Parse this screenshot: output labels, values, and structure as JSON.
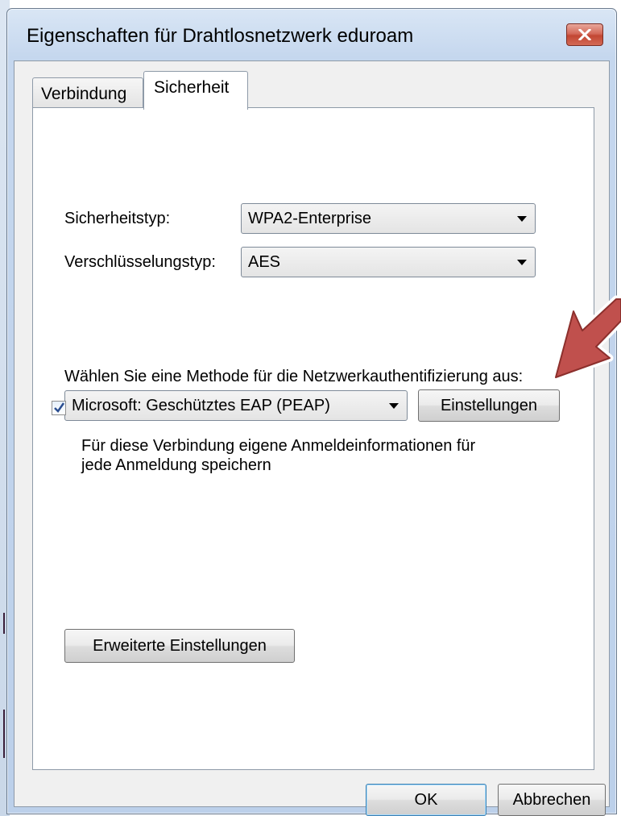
{
  "window": {
    "title": "Eigenschaften für Drahtlosnetzwerk eduroam",
    "close_icon": "close-icon"
  },
  "tabs": [
    {
      "label": "Verbindung",
      "active": false
    },
    {
      "label": "Sicherheit",
      "active": true
    }
  ],
  "security": {
    "type_label": "Sicherheitstyp:",
    "type_value": "WPA2-Enterprise",
    "encryption_label": "Verschlüsselungstyp:",
    "encryption_value": "AES"
  },
  "auth": {
    "method_label": "Wählen Sie eine Methode für die Netzwerkauthentifizierung aus:",
    "method_value": "Microsoft: Geschütztes EAP (PEAP)",
    "settings_button": "Einstellungen",
    "remember_checked": true,
    "remember_line1": "Für diese Verbindung eigene Anmeldeinformationen für",
    "remember_line2": "jede Anmeldung speichern"
  },
  "advanced_button": "Erweiterte Einstellungen",
  "footer": {
    "ok": "OK",
    "cancel": "Abbrechen"
  },
  "colors": {
    "annotation_arrow": "#c0504d",
    "titlebar": "#c5d7ee",
    "close_button": "#c24633"
  }
}
